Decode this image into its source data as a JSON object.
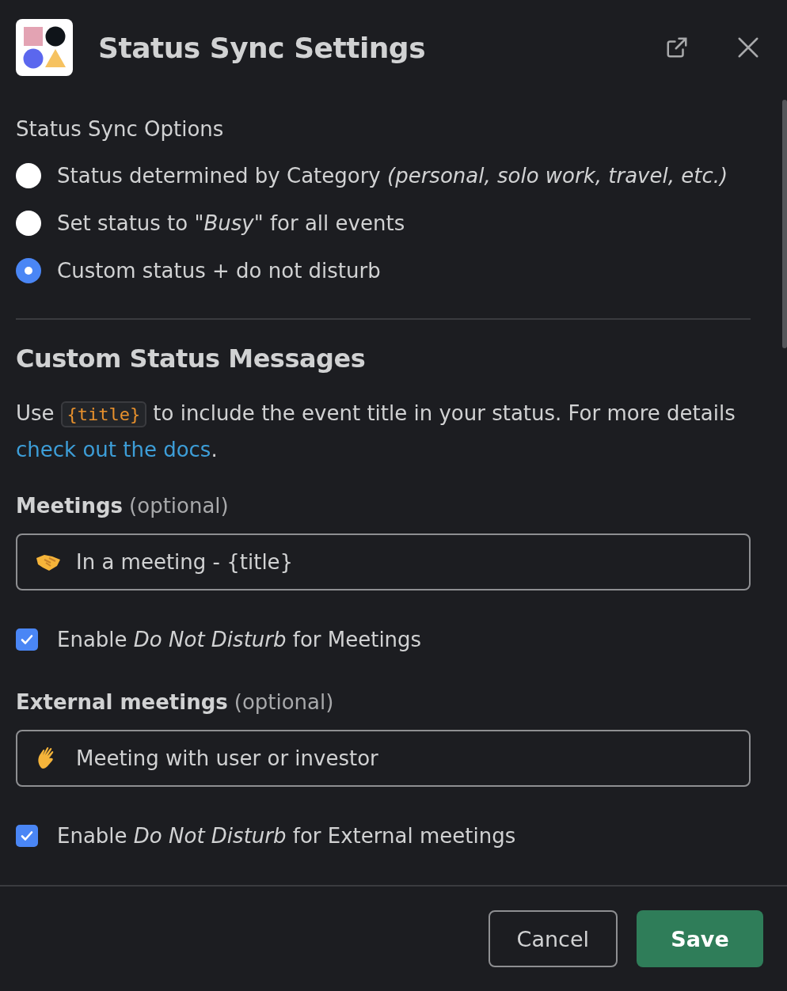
{
  "header": {
    "title": "Status Sync Settings"
  },
  "sync_options": {
    "heading": "Status Sync Options",
    "options": [
      {
        "label": "Status determined by Category *(personal, solo work, travel, etc.)*",
        "selected": false
      },
      {
        "label": "Set status to \"*Busy*\" for all events",
        "selected": false
      },
      {
        "label": "Custom status + do not disturb",
        "selected": true
      }
    ]
  },
  "custom_messages": {
    "heading": "Custom Status Messages",
    "intro_before": "Use",
    "code": "{title}",
    "intro_after": "to include the event title in your status. For more details",
    "link": "check out the docs",
    "intro_end": ".",
    "groups": [
      {
        "label": "Meetings",
        "hint": "(optional)",
        "kind": "meeting",
        "value": "In a meeting - {title}",
        "checkbox": {
          "label": "Enable *Do Not Disturb* for Meetings",
          "checked": true
        }
      },
      {
        "label": "External meetings",
        "hint": "(optional)",
        "kind": "external",
        "value": "Meeting with user or investor",
        "checkbox": {
          "label": "Enable *Do Not Disturb* for External meetings",
          "checked": true
        }
      }
    ]
  },
  "footer": {
    "buttons": [
      {
        "label": "Cancel",
        "kind": "secondary"
      },
      {
        "label": "Save",
        "kind": "primary"
      }
    ]
  }
}
